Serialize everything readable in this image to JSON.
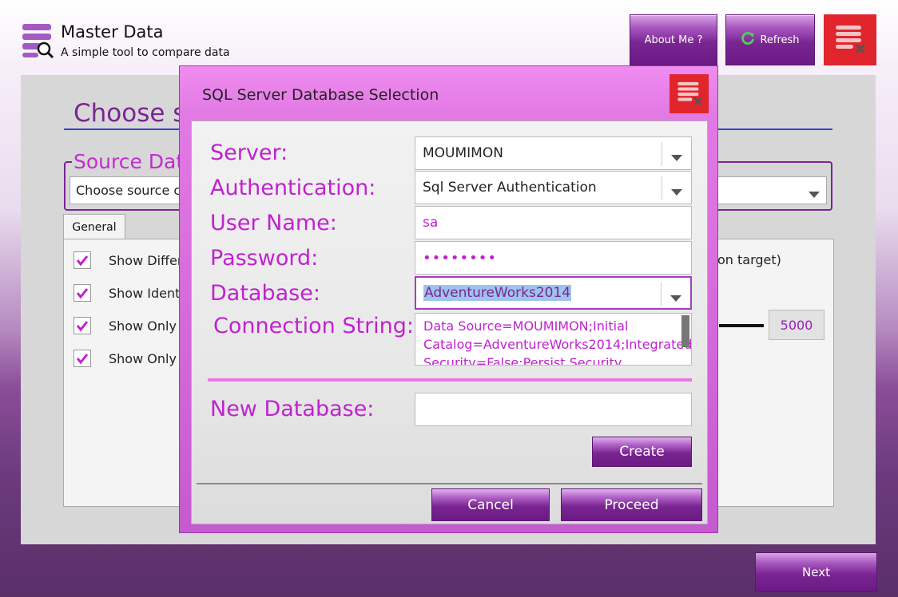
{
  "app": {
    "title": "Master Data",
    "subtitle": "A simple tool to compare data"
  },
  "toolbar": {
    "about_label": "About Me ?",
    "refresh_label": "Refresh",
    "close_icon": "close-list-icon"
  },
  "main": {
    "heading": "Choose so",
    "source_label": "Source Dat",
    "source_placeholder": "Choose source c",
    "tab_general": "General",
    "options": [
      {
        "label": "Show Differ",
        "checked": true
      },
      {
        "label": "Show Identi",
        "checked": true
      },
      {
        "label": "Show Only I",
        "checked": true
      },
      {
        "label": "Show Only I",
        "checked": true
      }
    ],
    "on_target_text": "on target)",
    "count_value": "5000",
    "next_label": "Next"
  },
  "dialog": {
    "title": "SQL Server Database Selection",
    "labels": {
      "server": "Server:",
      "authentication": "Authentication:",
      "username": "User Name:",
      "password": "Password:",
      "database": "Database:",
      "connection_string": "Connection String:",
      "new_database": "New Database:"
    },
    "values": {
      "server": "MOUMIMON",
      "authentication": "Sql Server Authentication",
      "username": "sa",
      "password": "••••••••",
      "database": "AdventureWorks2014",
      "connection_string": "Data Source=MOUMIMON;Initial Catalog=AdventureWorks2014;Integrated Security=False;Persist Security",
      "new_database": ""
    },
    "buttons": {
      "create": "Create",
      "cancel": "Cancel",
      "proceed": "Proceed"
    }
  },
  "colors": {
    "accent_purple": "#7a2592",
    "label_pink": "#c022cf",
    "close_red": "#e1252c"
  }
}
